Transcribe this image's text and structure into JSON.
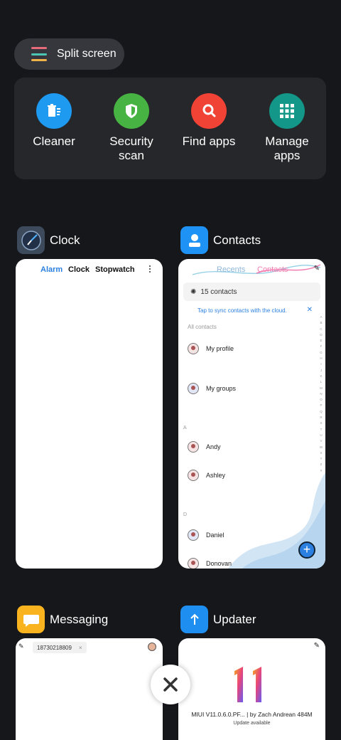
{
  "split_screen": {
    "label": "Split screen"
  },
  "tools": [
    {
      "label": "Cleaner",
      "icon": "broom-icon",
      "color": "#1e9af0"
    },
    {
      "label": "Security\nscan",
      "icon": "shield-icon",
      "color": "#47b342"
    },
    {
      "label": "Find apps",
      "icon": "magnifier-icon",
      "color": "#f04235"
    },
    {
      "label": "Manage\napps",
      "icon": "grid-icon",
      "color": "#129789"
    }
  ],
  "cards": {
    "clock": {
      "title": "Clock",
      "tabs": [
        "Alarm",
        "Clock",
        "Stopwatch"
      ]
    },
    "contacts": {
      "title": "Contacts",
      "tabs": [
        "Recents",
        "Contacts"
      ],
      "count": "15 contacts",
      "sync": "Tap to sync contacts with the cloud.",
      "all_contacts": "All contacts",
      "items": [
        {
          "name": "My profile"
        },
        {
          "name": "My groups"
        },
        {
          "name": "Andy"
        },
        {
          "name": "Ashley"
        },
        {
          "name": "Daniel"
        },
        {
          "name": "Donovan"
        }
      ],
      "sections": [
        "A",
        "D"
      ],
      "alphabet": [
        "A",
        "B",
        "C",
        "D",
        "E",
        "F",
        "G",
        "H",
        "I",
        "J",
        "K",
        "L",
        "M",
        "N",
        "O",
        "P",
        "Q",
        "R",
        "S",
        "T",
        "U",
        "V",
        "W",
        "X",
        "Y",
        "Z",
        "#"
      ]
    },
    "messaging": {
      "title": "Messaging",
      "number": "18730218809"
    },
    "updater": {
      "title": "Updater",
      "version": "MIUI V11.0.6.0.PF...",
      "by": "| by Zach Andrean 484M",
      "status": "Update available"
    }
  },
  "colors": {
    "background": "#16171b",
    "accent_blue": "#2b7fe0"
  }
}
